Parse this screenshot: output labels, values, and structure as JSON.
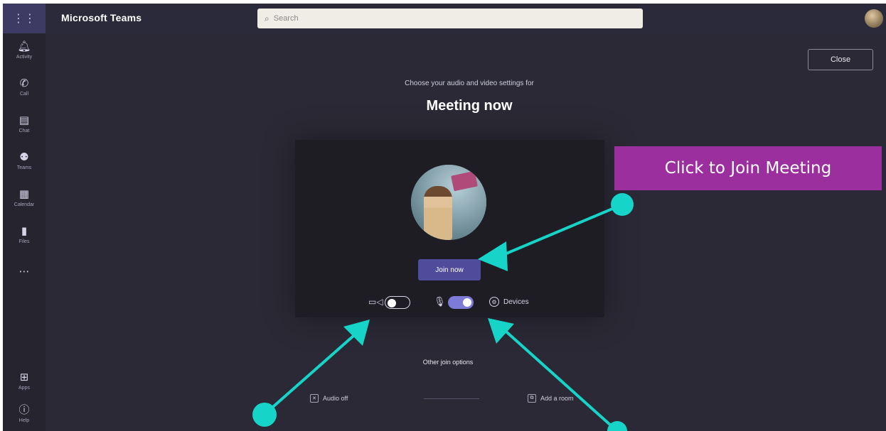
{
  "header": {
    "app_title": "Microsoft Teams",
    "search_placeholder": "Search",
    "waffle_icon": "app-launcher-icon"
  },
  "rail": {
    "items": [
      {
        "label": "Activity",
        "icon": "bell-icon"
      },
      {
        "label": "Call",
        "icon": "phone-icon"
      },
      {
        "label": "Chat",
        "icon": "chat-icon"
      },
      {
        "label": "Teams",
        "icon": "teams-icon"
      },
      {
        "label": "Calendar",
        "icon": "calendar-icon"
      },
      {
        "label": "Files",
        "icon": "file-icon"
      },
      {
        "label": "",
        "icon": "more-icon"
      }
    ],
    "bottom": [
      {
        "label": "Apps",
        "icon": "apps-icon"
      },
      {
        "label": "Help",
        "icon": "help-icon"
      }
    ]
  },
  "main": {
    "close_label": "Close",
    "subtitle": "Choose your audio and video settings for",
    "meeting_title": "Meeting now",
    "join_label": "Join now",
    "devices_label": "Devices",
    "other_options": "Other join options",
    "audio_off_label": "Audio off",
    "add_room_label": "Add a room",
    "camera_on": false,
    "mic_on": true
  },
  "annotation": {
    "text": "Click to Join Meeting"
  },
  "colors": {
    "accent": "#4f4c9c",
    "annotation_bg": "#9b2f9d",
    "arrow": "#17d4c8"
  }
}
